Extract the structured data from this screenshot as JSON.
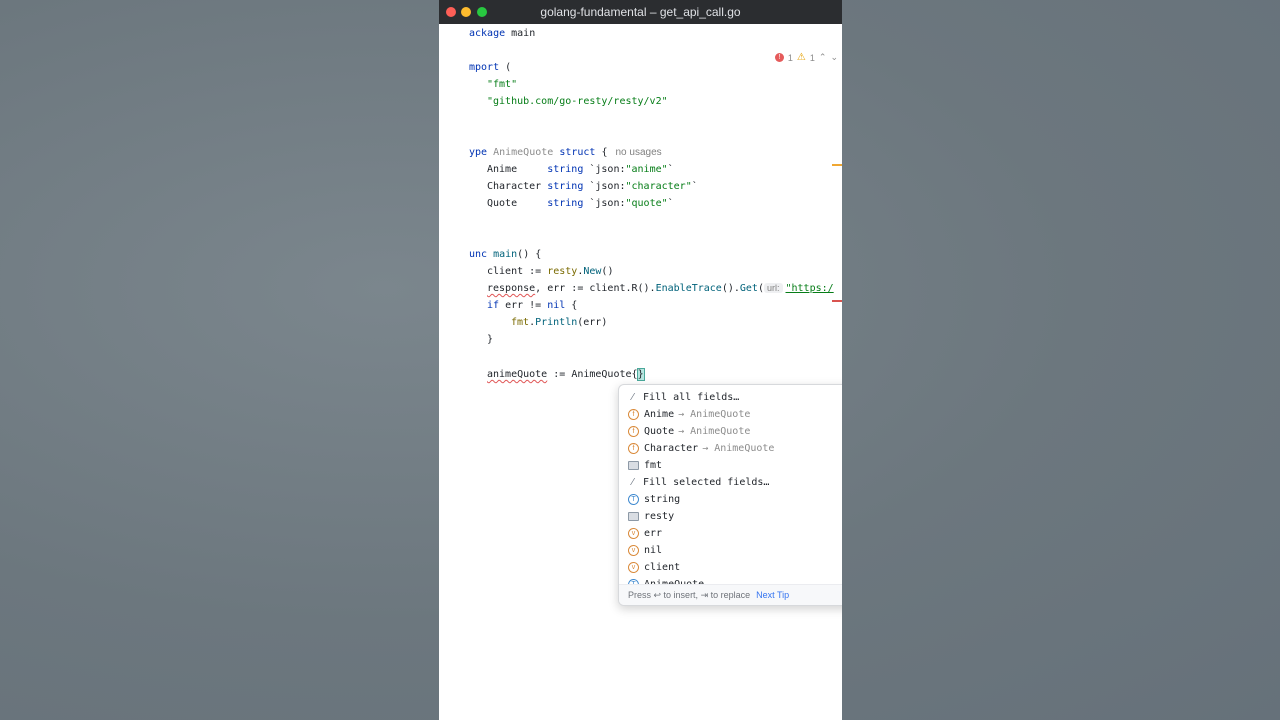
{
  "window": {
    "title": "golang-fundamental – get_api_call.go"
  },
  "inspections": {
    "errors": "1",
    "warnings": "1"
  },
  "code": {
    "l1_kw": "ackage",
    "l1_rest": " main",
    "l3_kw": "mport",
    "l3_rest": " (",
    "l4": "\"fmt\"",
    "l5": "\"github.com/go-resty/resty/v2\"",
    "l8_kw": "ype",
    "l8_name": " AnimeQuote",
    "l8_kw2": " struct",
    "l8_rest": " {",
    "l8_hint": "no usages",
    "f1_name": "Anime     ",
    "f1_type": "string",
    "f1_tag_a": " `json:",
    "f1_tag_b": "\"anime\"",
    "f1_tag_c": "`",
    "f2_name": "Character ",
    "f2_type": "string",
    "f2_tag_a": " `json:",
    "f2_tag_b": "\"character\"",
    "f2_tag_c": "`",
    "f3_name": "Quote     ",
    "f3_type": "string",
    "f3_tag_a": " `json:",
    "f3_tag_b": "\"quote\"",
    "f3_tag_c": "`",
    "l14_kw": "unc",
    "l14_fn": " main",
    "l14_rest": "() {",
    "l15_a": "client := ",
    "l15_b": "resty",
    "l15_c": ".",
    "l15_d": "New",
    "l15_e": "()",
    "l16_a": "response",
    "l16_b": ", err := client.R().",
    "l16_c": "EnableTrace",
    "l16_d": "().",
    "l16_e": "Get",
    "l16_f": "(",
    "l16_hint": "url:",
    "l16_g": "\"https:/",
    "l17_a": "if",
    "l17_b": " err != ",
    "l17_c": "nil",
    "l17_d": " {",
    "l18_a": "fmt",
    "l18_b": ".",
    "l18_c": "Println",
    "l18_d": "(err)",
    "l19": "}",
    "l21_a": "animeQuote",
    "l21_b": " := ",
    "l21_c": "AnimeQuote",
    "l21_d": "{",
    "l21_e": "}"
  },
  "completion": {
    "items": [
      {
        "icon": "wand",
        "label": "Fill all fields…",
        "tail": ""
      },
      {
        "icon": "f",
        "label": "Anime",
        "tail": "→ AnimeQuote"
      },
      {
        "icon": "f",
        "label": "Quote",
        "tail": "→ AnimeQuote"
      },
      {
        "icon": "f",
        "label": "Character",
        "tail": "→ AnimeQuote"
      },
      {
        "icon": "pkg",
        "label": "fmt",
        "tail": ""
      },
      {
        "icon": "wand",
        "label": "Fill selected fields…",
        "tail": ""
      },
      {
        "icon": "T",
        "label": "string",
        "tail": ""
      },
      {
        "icon": "pkg",
        "label": "resty",
        "tail": ""
      },
      {
        "icon": "v",
        "label": "err",
        "tail": ""
      },
      {
        "icon": "v",
        "label": "nil",
        "tail": ""
      },
      {
        "icon": "v",
        "label": "client",
        "tail": ""
      },
      {
        "icon": "T",
        "label": "AnimeQuote",
        "tail": ""
      }
    ],
    "footer_text": "Press ↩ to insert, ⇥ to replace",
    "footer_link": "Next Tip"
  }
}
